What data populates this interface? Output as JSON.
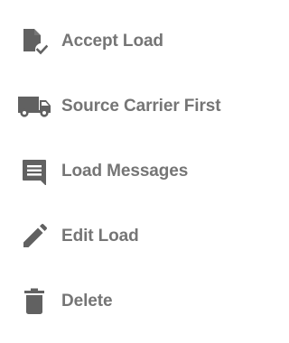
{
  "menu": {
    "items": [
      {
        "label": "Accept Load",
        "icon": "file-check-icon"
      },
      {
        "label": "Source Carrier First",
        "icon": "truck-icon"
      },
      {
        "label": "Load Messages",
        "icon": "message-icon"
      },
      {
        "label": "Edit Load",
        "icon": "pencil-icon"
      },
      {
        "label": "Delete",
        "icon": "trash-icon"
      }
    ]
  },
  "colors": {
    "text": "#757575",
    "icon": "#616161"
  }
}
